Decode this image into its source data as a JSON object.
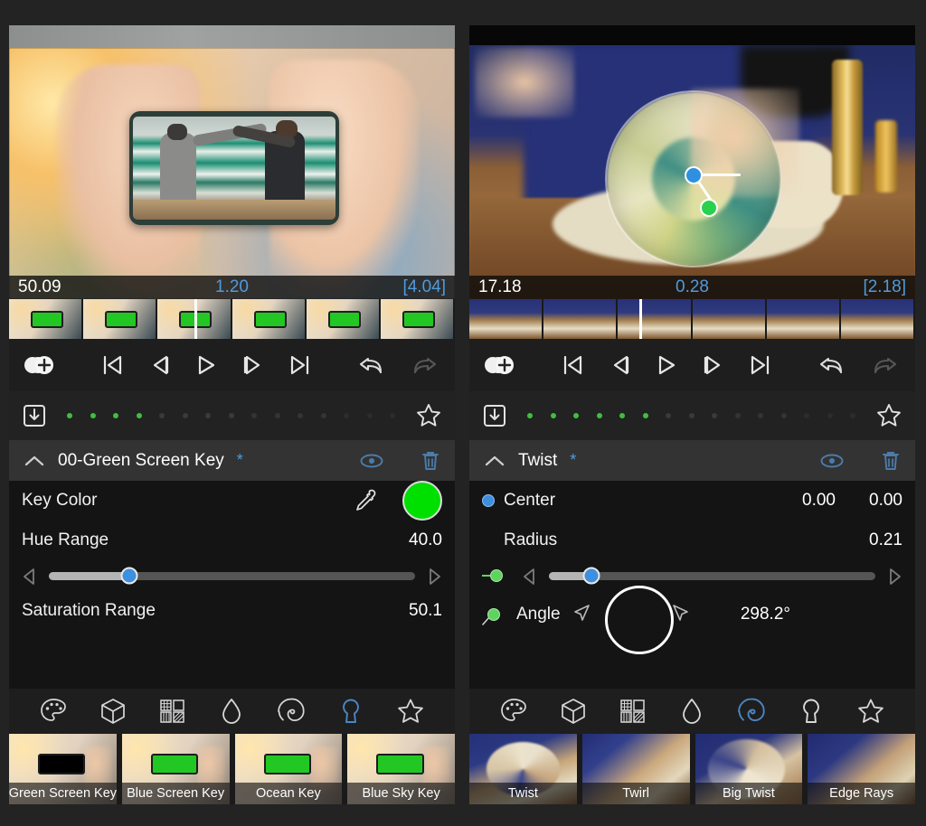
{
  "app": {
    "name": "video-effect-editor"
  },
  "panels": [
    {
      "id": "left",
      "preview": {
        "timecode_current": "50.09",
        "timecode_position": "1.20",
        "timecode_duration": "[4.04]"
      },
      "transport": {
        "add_keyframe": "add-keyframe-icon",
        "skip_back": "skip-to-start-icon",
        "step_back": "step-backward-icon",
        "play": "play-icon",
        "step_forward": "step-forward-icon",
        "skip_forward": "skip-to-end-icon",
        "undo": "undo-icon",
        "redo": "redo-icon"
      },
      "keyframes": {
        "save_icon": "save-preset-icon",
        "favorite_icon": "favorite-star-icon",
        "total_dots": 15,
        "active_dots": 4
      },
      "section": {
        "title": "00-Green Screen Key",
        "modified_marker": "*",
        "collapse_icon": "chevron-up-icon",
        "visibility_icon": "eye-icon",
        "delete_icon": "trash-icon"
      },
      "parameters": [
        {
          "label": "Key Color",
          "value": "",
          "type": "color",
          "color": "#00e000",
          "picker_icon": "eyedropper-icon"
        },
        {
          "label": "Hue Range",
          "value": "40.0",
          "type": "slider",
          "fill_percent": 22
        },
        {
          "label": "Saturation Range",
          "value": "50.1",
          "type": "value"
        }
      ],
      "toolbar_icons": [
        {
          "name": "palette-icon",
          "active": false
        },
        {
          "name": "cube-icon",
          "active": false
        },
        {
          "name": "pattern-grid-icon",
          "active": false
        },
        {
          "name": "droplet-icon",
          "active": false
        },
        {
          "name": "spiral-icon",
          "active": false
        },
        {
          "name": "keyhole-icon",
          "active": true
        },
        {
          "name": "star-icon",
          "active": false
        }
      ],
      "presets": [
        {
          "label": "Green Screen Key",
          "selected": true
        },
        {
          "label": "Blue Screen Key",
          "selected": false
        },
        {
          "label": "Ocean Key",
          "selected": false
        },
        {
          "label": "Blue Sky Key",
          "selected": false
        }
      ]
    },
    {
      "id": "right",
      "preview": {
        "timecode_current": "17.18",
        "timecode_position": "0.28",
        "timecode_duration": "[2.18]"
      },
      "transport": {
        "add_keyframe": "add-keyframe-icon",
        "skip_back": "skip-to-start-icon",
        "step_back": "step-backward-icon",
        "play": "play-icon",
        "step_forward": "step-forward-icon",
        "skip_forward": "skip-to-end-icon",
        "undo": "undo-icon",
        "redo": "redo-icon"
      },
      "keyframes": {
        "save_icon": "save-preset-icon",
        "favorite_icon": "favorite-star-icon",
        "total_dots": 15,
        "active_dots": 6
      },
      "section": {
        "title": "Twist",
        "modified_marker": "*",
        "collapse_icon": "chevron-up-icon",
        "visibility_icon": "eye-icon",
        "delete_icon": "trash-icon"
      },
      "parameters": [
        {
          "label": "Center",
          "value_x": "0.00",
          "value_y": "0.00",
          "type": "xy",
          "keyframe": "blue"
        },
        {
          "label": "Radius",
          "value": "0.21",
          "type": "slider",
          "fill_percent": 13,
          "keyframe": "green"
        },
        {
          "label": "Angle",
          "value": "298.2°",
          "type": "dial",
          "keyframe": "green"
        }
      ],
      "toolbar_icons": [
        {
          "name": "palette-icon",
          "active": false
        },
        {
          "name": "cube-icon",
          "active": false
        },
        {
          "name": "pattern-grid-icon",
          "active": false
        },
        {
          "name": "droplet-icon",
          "active": false
        },
        {
          "name": "spiral-icon",
          "active": true
        },
        {
          "name": "keyhole-icon",
          "active": false
        },
        {
          "name": "star-icon",
          "active": false
        }
      ],
      "presets": [
        {
          "label": "Twist",
          "selected": true
        },
        {
          "label": "Twirl",
          "selected": false
        },
        {
          "label": "Big Twist",
          "selected": false
        },
        {
          "label": "Edge Rays",
          "selected": false
        }
      ]
    }
  ],
  "colors": {
    "accent_blue": "#3d8fe0",
    "keyframe_green": "#3fbf3f",
    "key_color_green": "#00e000",
    "panel_bg": "#1a1a1a",
    "header_bg": "#333333",
    "app_bg": "#232323"
  }
}
